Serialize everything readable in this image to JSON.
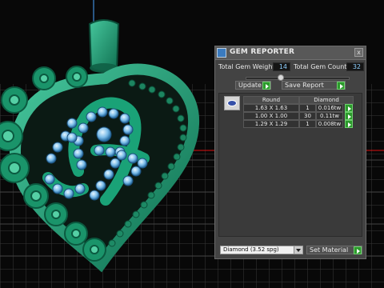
{
  "panel": {
    "title": "GEM REPORTER",
    "close_glyph": "x",
    "total_gem_weight_label": "Total Gem Weight",
    "total_gem_weight_value": "14",
    "total_gem_count_label": "Total Gem Count",
    "total_gem_count_value": "32",
    "update_label": "Update",
    "save_report_label": "Save Report",
    "table": {
      "headers": [
        "Round",
        "Diamond"
      ],
      "rows": [
        {
          "size": "1.63 X 1.63",
          "count": "1",
          "weight": "0.016tw"
        },
        {
          "size": "1.00 X 1.00",
          "count": "30",
          "weight": "0.11tw"
        },
        {
          "size": "1.29 X 1.29",
          "count": "1",
          "weight": "0.008tw"
        }
      ]
    },
    "material_select_value": "Diamond    (3.52 spg)",
    "set_material_label": "Set Material"
  },
  "colors": {
    "jewel_green": "#1f8f68",
    "gem_blue": "#8fc9f0",
    "grid_line": "#3a3a3a"
  },
  "icons": {
    "app": "gem-reporter-icon",
    "close": "close-icon",
    "go": "green-arrow-icon"
  }
}
